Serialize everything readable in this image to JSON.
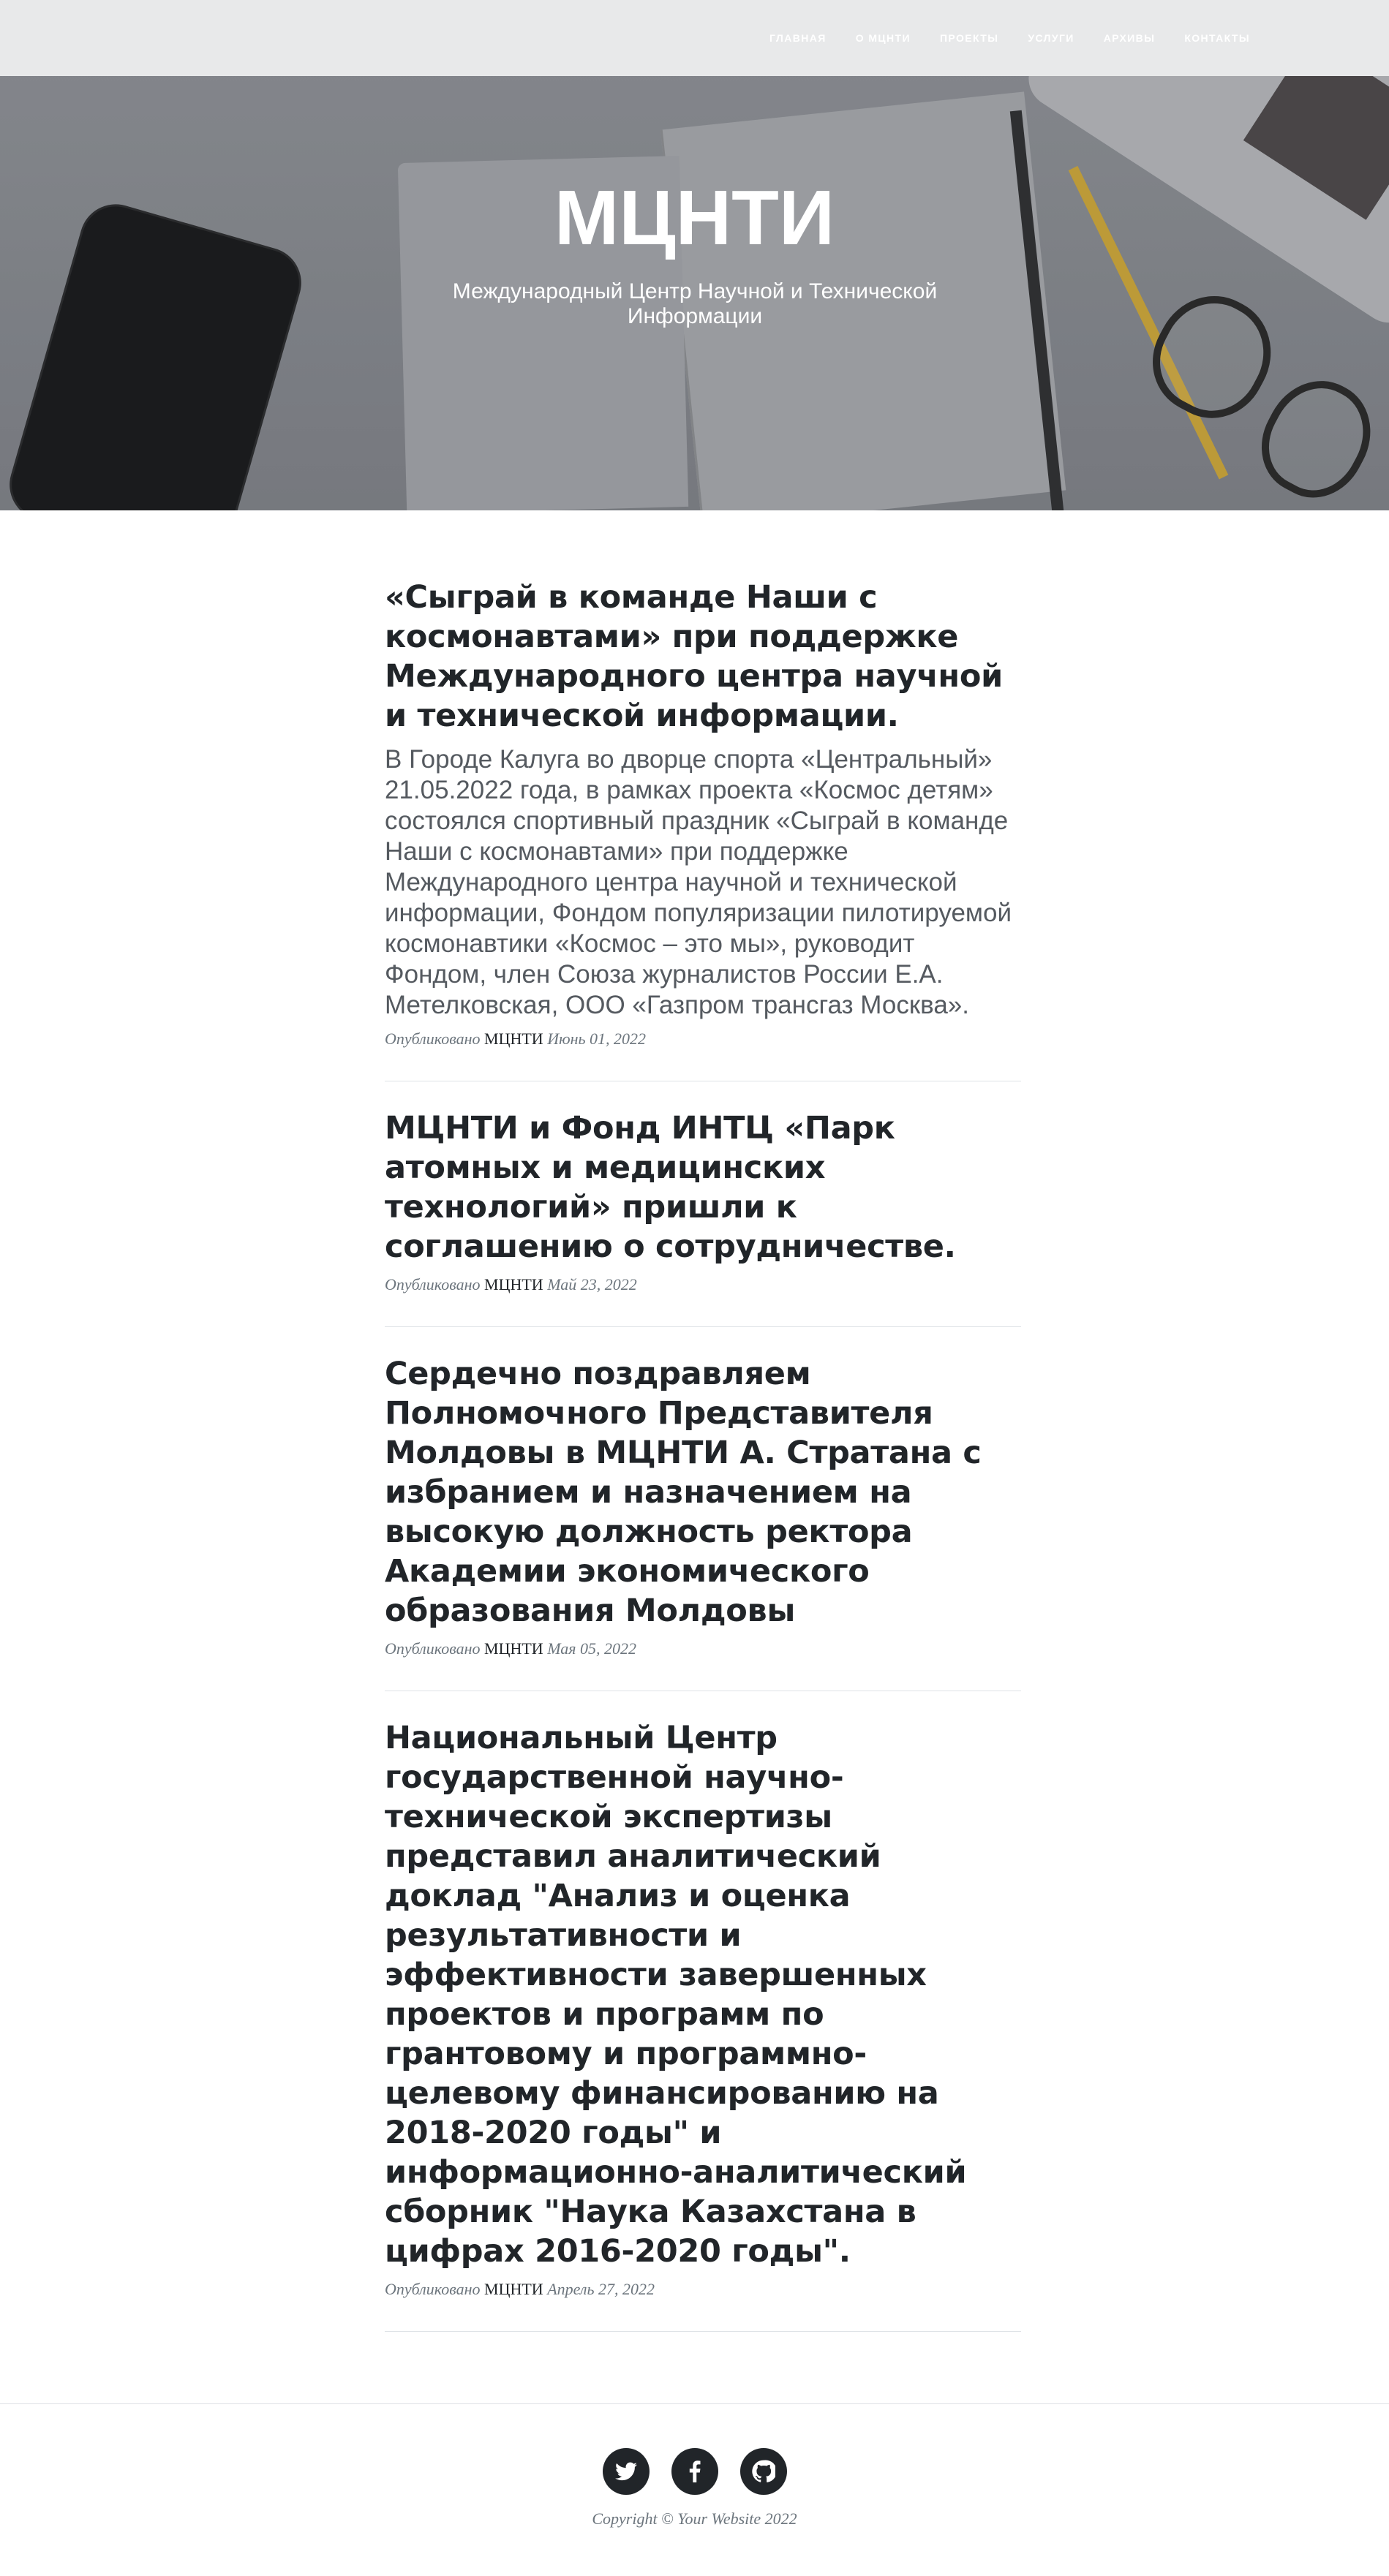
{
  "nav": {
    "items": [
      {
        "label": "ГЛАВНАЯ"
      },
      {
        "label": "О МЦНТИ"
      },
      {
        "label": "ПРОЕКТЫ"
      },
      {
        "label": "УСЛУГИ"
      },
      {
        "label": "АРХИВЫ"
      },
      {
        "label": "КОНТАКТЫ"
      }
    ]
  },
  "hero": {
    "title": "МЦНТИ",
    "subtitle": "Международный Центр Научной и Технической Информации"
  },
  "posts": [
    {
      "title": "«Сыграй в команде Наши с космонавтами» при поддержке Международного центра научной и технической информации.",
      "subtitle": "В Городе Калуга во дворце спорта «Центральный» 21.05.2022 года, в рамках проекта «Космос детям» состоялся спортивный праздник «Сыграй в команде Наши с космонавтами» при поддержке Международного центра научной и технической информации, Фондом популяризации пилотируемой космонавтики «Космос – это мы», руководит Фондом, член Союза журналистов России Е.А. Метелковская, ООО «Газпром трансгаз Москва».",
      "meta_prefix": "Опубликовано",
      "author": "МЦНТИ",
      "date": "Июнь 01, 2022"
    },
    {
      "title": "МЦНТИ и Фонд ИНТЦ «Парк атомных и медицинских технологий» пришли к соглашению о сотрудничестве.",
      "meta_prefix": "Опубликовано",
      "author": "МЦНТИ",
      "date": "Май 23, 2022"
    },
    {
      "title": "Сердечно поздравляем Полномочного Представителя Молдовы в МЦНТИ А. Стратана с избранием и назначением на высокую должность ректора Академии экономического образования Молдовы",
      "meta_prefix": "Опубликовано",
      "author": "МЦНТИ",
      "date": "Мая 05, 2022"
    },
    {
      "title": "Национальный Центр государственной научно-технической экспертизы представил аналитический доклад \"Анализ и оценка результативности и эффективности завершенных проектов и программ по грантовому и программно-целевому финансированию на 2018-2020 годы\" и информационно-аналитический сборник \"Наука Казахстана в цифрах 2016-2020 годы\".",
      "meta_prefix": "Опубликовано",
      "author": "МЦНТИ",
      "date": "Апрель 27, 2022"
    }
  ],
  "footer": {
    "social": [
      {
        "icon": "twitter-icon"
      },
      {
        "icon": "facebook-icon"
      },
      {
        "icon": "github-icon"
      }
    ],
    "copyright": "Copyright © Your Website 2022"
  }
}
